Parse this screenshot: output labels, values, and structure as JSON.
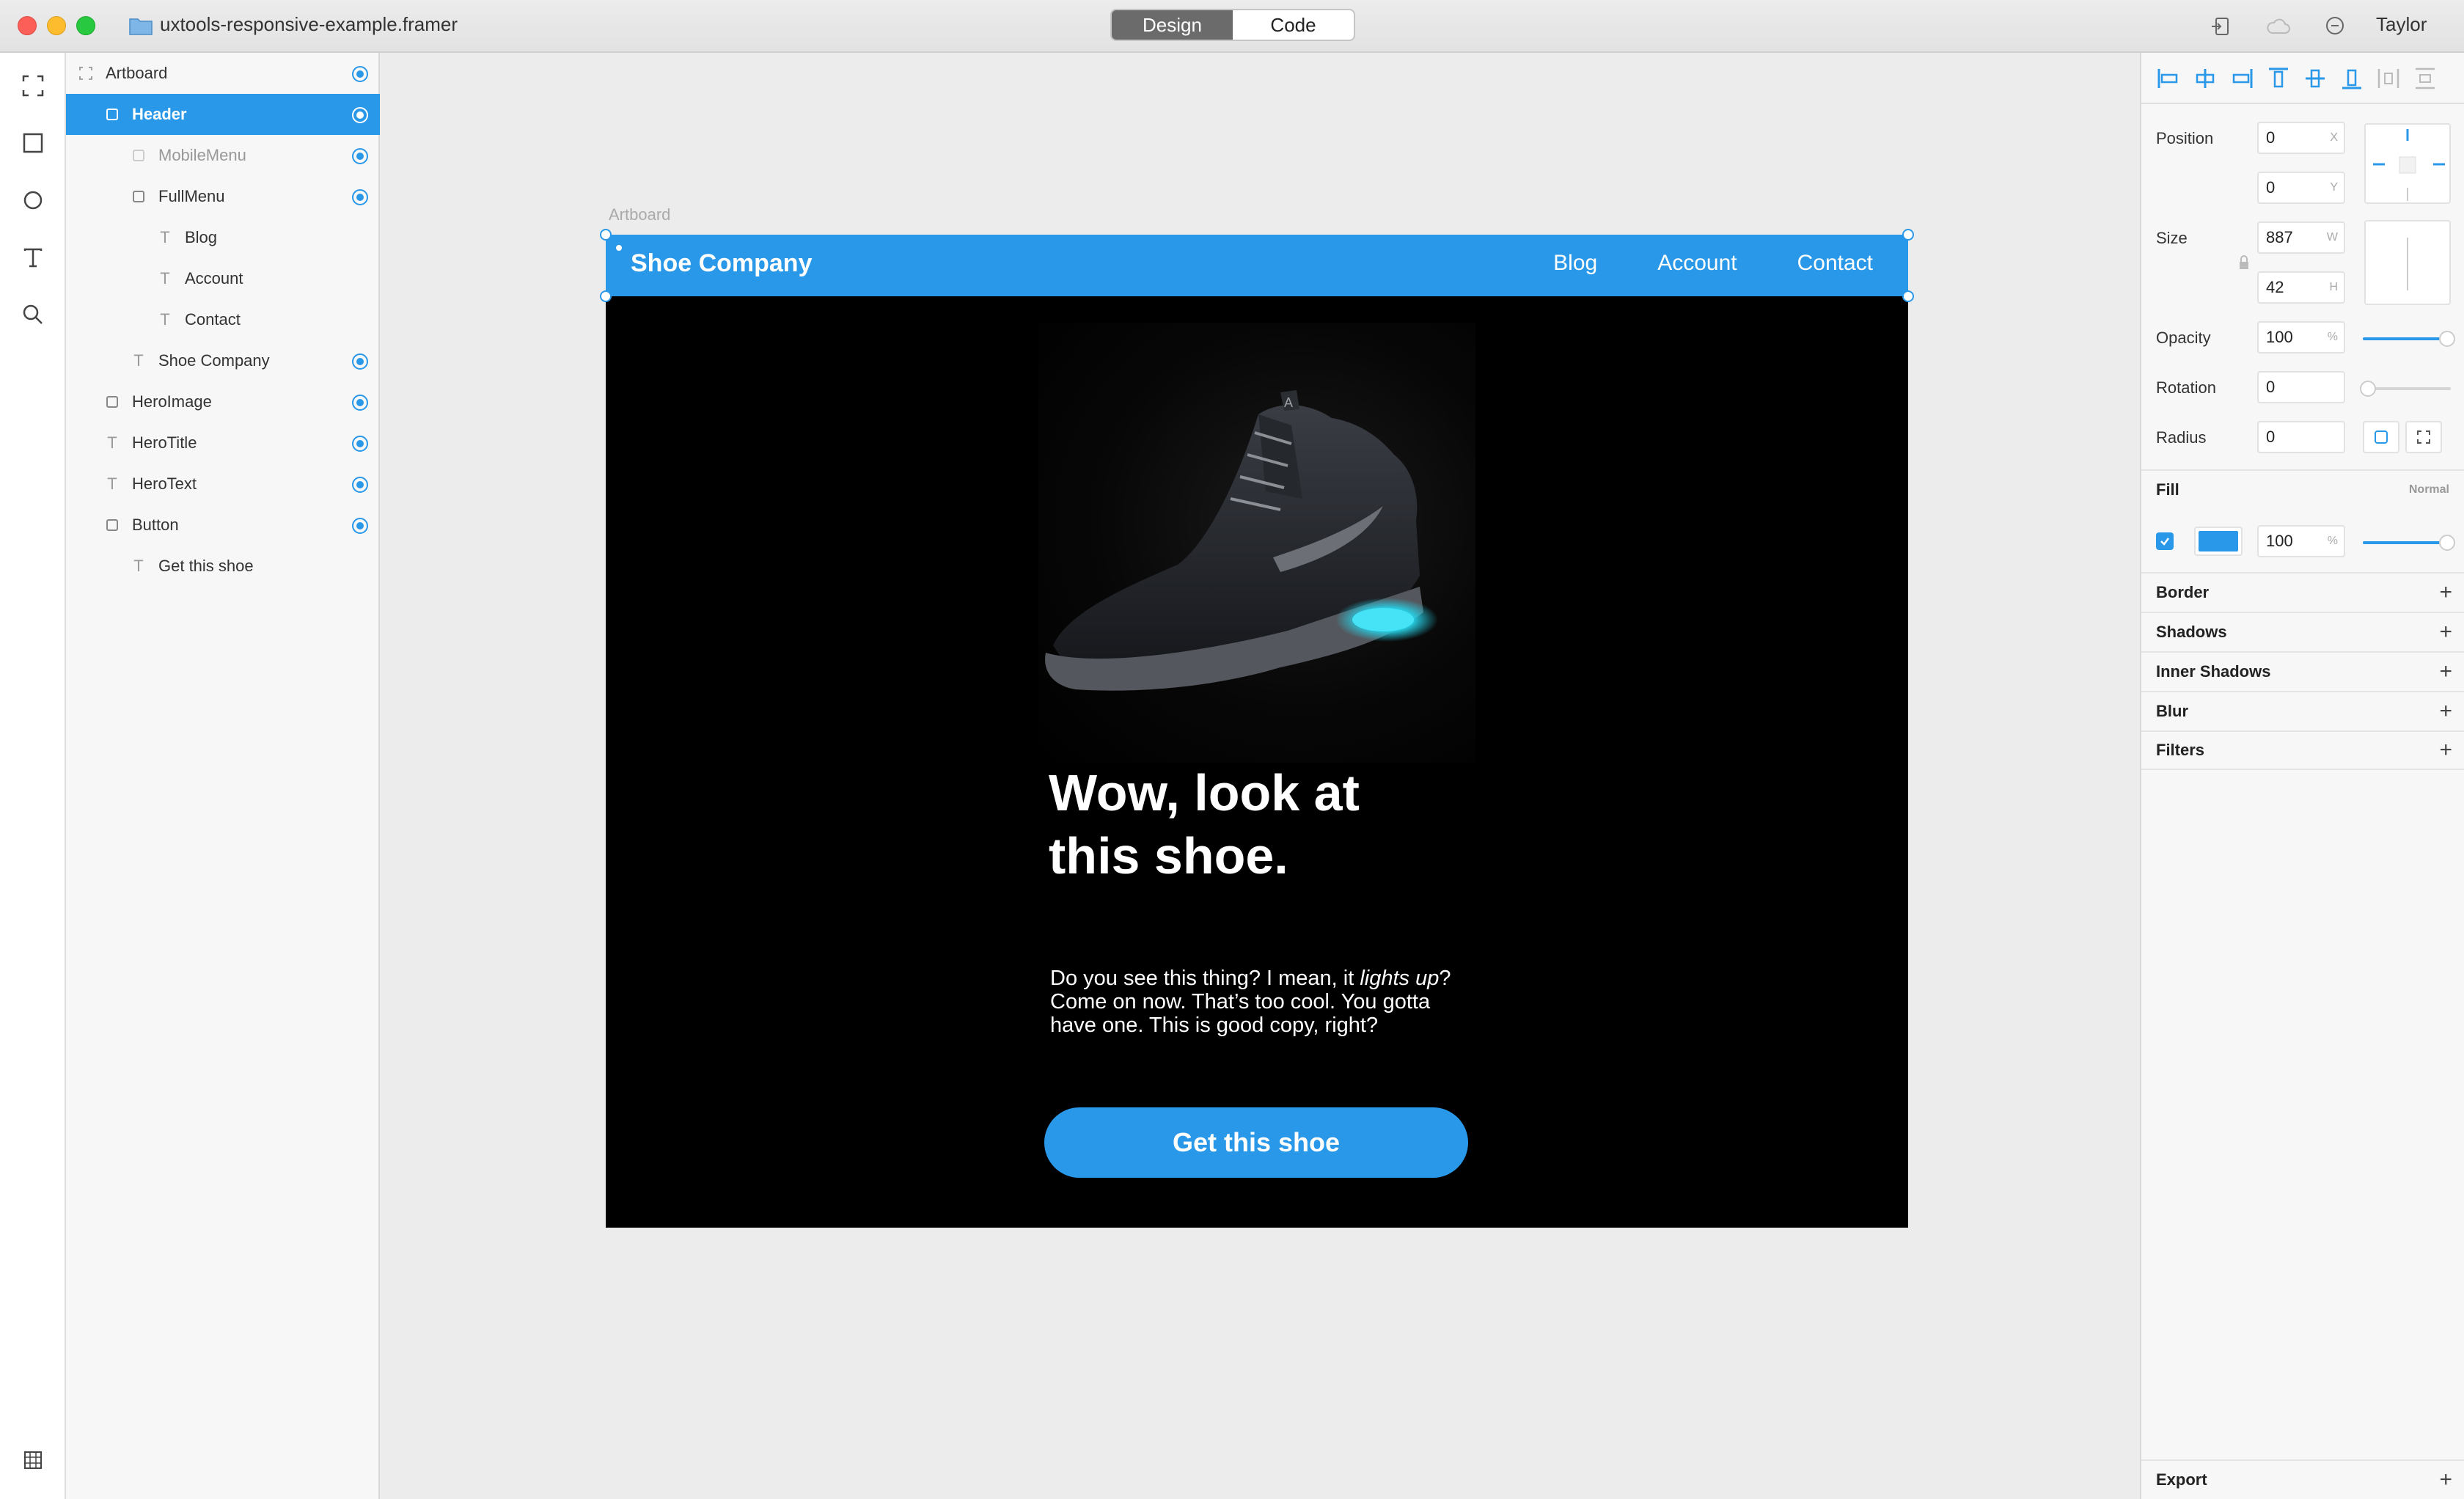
{
  "window": {
    "title": "uxtools-responsive-example.framer",
    "user": "Taylor"
  },
  "mode_tabs": [
    {
      "label": "Design",
      "active": true
    },
    {
      "label": "Code",
      "active": false
    }
  ],
  "tools": [
    "frame-tool-icon",
    "rectangle-tool-icon",
    "oval-tool-icon",
    "text-tool-icon",
    "search-icon"
  ],
  "layers": [
    {
      "label": "Artboard",
      "indent": 0,
      "icon": "artboard-icon",
      "visible": true,
      "selected": false
    },
    {
      "label": "Header",
      "indent": 1,
      "icon": "frame-icon",
      "visible": true,
      "selected": true
    },
    {
      "label": "MobileMenu",
      "indent": 2,
      "icon": "frame-icon",
      "visible": true,
      "selected": false,
      "dim": true
    },
    {
      "label": "FullMenu",
      "indent": 2,
      "icon": "frame-icon",
      "visible": true,
      "selected": false
    },
    {
      "label": "Blog",
      "indent": 3,
      "icon": "text-icon",
      "visible": false,
      "selected": false
    },
    {
      "label": "Account",
      "indent": 3,
      "icon": "text-icon",
      "visible": false,
      "selected": false
    },
    {
      "label": "Contact",
      "indent": 3,
      "icon": "text-icon",
      "visible": false,
      "selected": false
    },
    {
      "label": "Shoe Company",
      "indent": 2,
      "icon": "text-icon",
      "visible": true,
      "selected": false
    },
    {
      "label": "HeroImage",
      "indent": 1,
      "icon": "frame-icon",
      "visible": true,
      "selected": false
    },
    {
      "label": "HeroTitle",
      "indent": 1,
      "icon": "text-icon",
      "visible": true,
      "selected": false
    },
    {
      "label": "HeroText",
      "indent": 1,
      "icon": "text-icon",
      "visible": true,
      "selected": false
    },
    {
      "label": "Button",
      "indent": 1,
      "icon": "frame-icon",
      "visible": true,
      "selected": false
    },
    {
      "label": "Get this shoe",
      "indent": 2,
      "icon": "text-icon",
      "visible": false,
      "selected": false
    }
  ],
  "artboard": {
    "label": "Artboard",
    "brand": "Shoe Company",
    "nav": [
      "Blog",
      "Account",
      "Contact"
    ],
    "hero_title": "Wow, look at this shoe.",
    "hero_text_before": "Do you see this thing? I mean, it ",
    "hero_text_em": "lights up",
    "hero_text_after": "? Come on now. That’s too cool. You gotta have one. This is good copy, right?",
    "cta": "Get this shoe",
    "accent": "#2a98e8",
    "background": "#000000"
  },
  "properties": {
    "position_label": "Position",
    "x": "0",
    "x_unit": "X",
    "y": "0",
    "y_unit": "Y",
    "size_label": "Size",
    "w": "887",
    "w_unit": "W",
    "h": "42",
    "h_unit": "H",
    "opacity_label": "Opacity",
    "opacity": "100",
    "opacity_unit": "%",
    "opacity_level": 1.0,
    "rotation_label": "Rotation",
    "rotation": "0",
    "radius_label": "Radius",
    "radius": "0",
    "fill_label": "Fill",
    "fill_mode": "Normal",
    "fill_color": "#2a98e8",
    "fill_opacity": "100",
    "fill_opacity_unit": "%",
    "sections": [
      "Border",
      "Shadows",
      "Inner Shadows",
      "Blur",
      "Filters"
    ],
    "export_label": "Export"
  }
}
